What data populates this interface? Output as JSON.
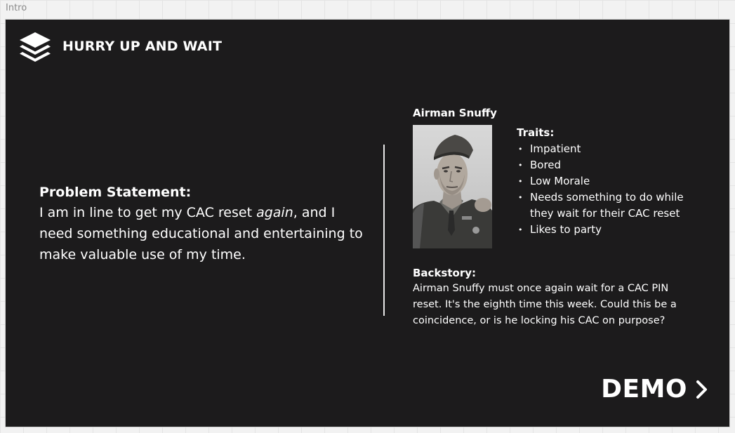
{
  "frame": {
    "label": "Intro"
  },
  "header": {
    "icon": "layers-icon",
    "title": "HURRY UP AND WAIT"
  },
  "problem": {
    "heading": "Problem Statement:",
    "text_before": "I am in line to get my CAC reset ",
    "text_emphasis": "again",
    "text_after": ", and I need something educational and entertaining to make valuable use of my time."
  },
  "persona": {
    "name": "Airman Snuffy",
    "photo_icon": "soldier-portrait",
    "traits_heading": "Traits:",
    "traits": [
      "Impatient",
      "Bored",
      "Low Morale",
      "Needs something to do while they wait for their CAC reset",
      "Likes to party"
    ],
    "backstory_heading": "Backstory:",
    "backstory": "Airman Snuffy must once again wait for a CAC PIN reset. It's the eighth time this week. Could this be a coincidence, or is he locking his CAC on purpose?"
  },
  "demo": {
    "label": "DEMO",
    "icon": "chevron-right-icon"
  },
  "colors": {
    "slide_background": "#1c1b1c",
    "canvas_background": "#f2f2f2",
    "text": "#ffffff"
  }
}
